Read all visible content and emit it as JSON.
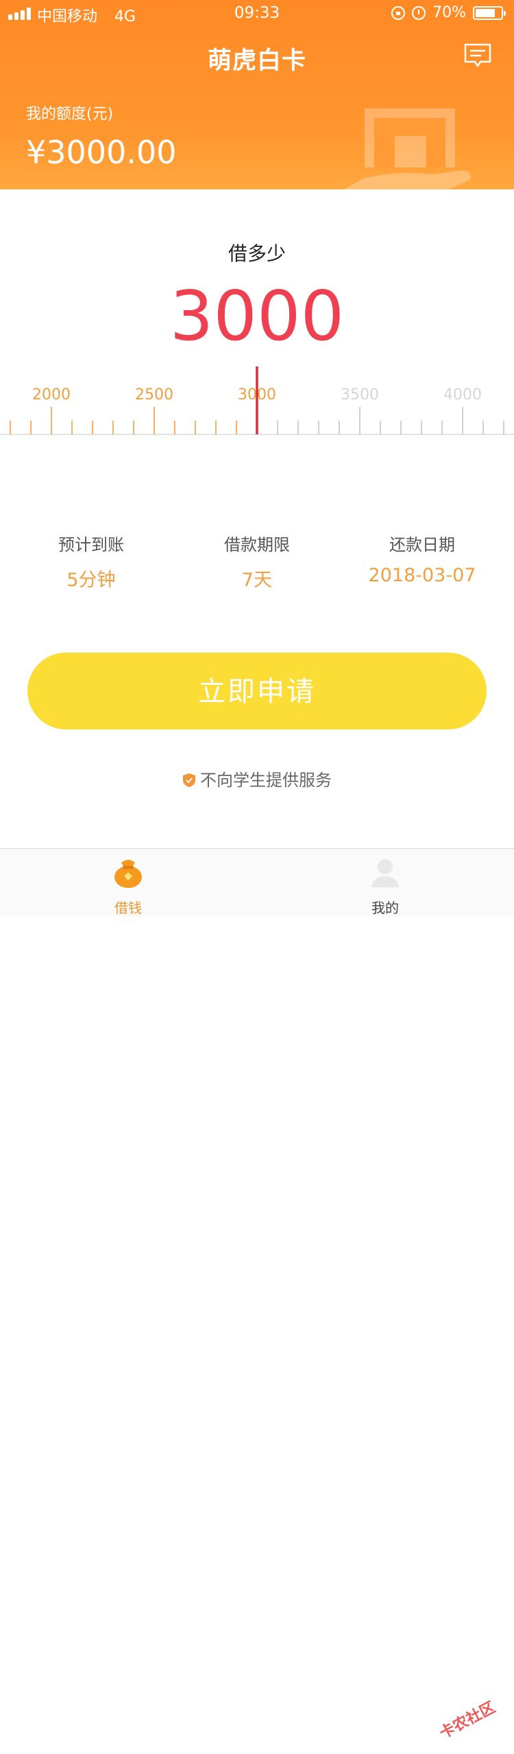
{
  "status_bar": {
    "carrier": "中国移动",
    "network": "4G",
    "time": "09:33",
    "battery": "70%"
  },
  "header": {
    "title": "萌虎白卡",
    "limit_label": "我的额度(元)",
    "limit_amount": "¥3000.00",
    "icons": [
      "message-icon",
      "hand-box-illustration"
    ]
  },
  "borrow": {
    "label": "借多少",
    "amount": "3000",
    "ruler_ticks": [
      "2000",
      "2500",
      "3000",
      "3500",
      "4000"
    ],
    "selected_value": 3000
  },
  "info": [
    {
      "label": "预计到账",
      "value": "5分钟"
    },
    {
      "label": "借款期限",
      "value": "7天"
    },
    {
      "label": "还款日期",
      "value": "2018-03-07"
    }
  ],
  "apply_button": "立即申请",
  "notice": "不向学生提供服务",
  "tabs": [
    {
      "label": "借钱",
      "icon": "money-bag-icon",
      "active": true
    },
    {
      "label": "我的",
      "icon": "user-icon",
      "active": false
    }
  ],
  "watermark": "卡农社区",
  "colors": {
    "brand_orange": "#ff8a25",
    "amount_red": "#ee4050",
    "accent_orange": "#f0a040",
    "button_yellow": "#fbdd35"
  }
}
